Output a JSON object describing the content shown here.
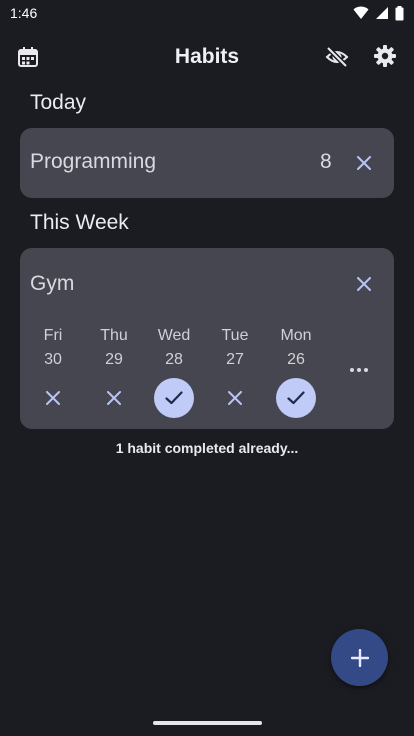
{
  "status_bar": {
    "time": "1:46"
  },
  "app_bar": {
    "title": "Habits",
    "left_icon": "calendar-icon",
    "right_icons": [
      "visibility-off-icon",
      "gear-icon"
    ]
  },
  "sections": {
    "today": {
      "title": "Today",
      "habits": [
        {
          "name": "Programming",
          "count": "8"
        }
      ]
    },
    "week": {
      "title": "This Week",
      "habits": [
        {
          "name": "Gym",
          "days": [
            {
              "day": "Fri",
              "date": "30",
              "done": false
            },
            {
              "day": "Thu",
              "date": "29",
              "done": false
            },
            {
              "day": "Wed",
              "date": "28",
              "done": true
            },
            {
              "day": "Tue",
              "date": "27",
              "done": false
            },
            {
              "day": "Mon",
              "date": "26",
              "done": true
            }
          ]
        }
      ]
    }
  },
  "summary": "1 habit completed already...",
  "colors": {
    "background": "#1b1c22",
    "card": "#45464f",
    "accent": "#b8c4f5",
    "check_fill": "#c0cbf7",
    "fab": "#334a87"
  }
}
